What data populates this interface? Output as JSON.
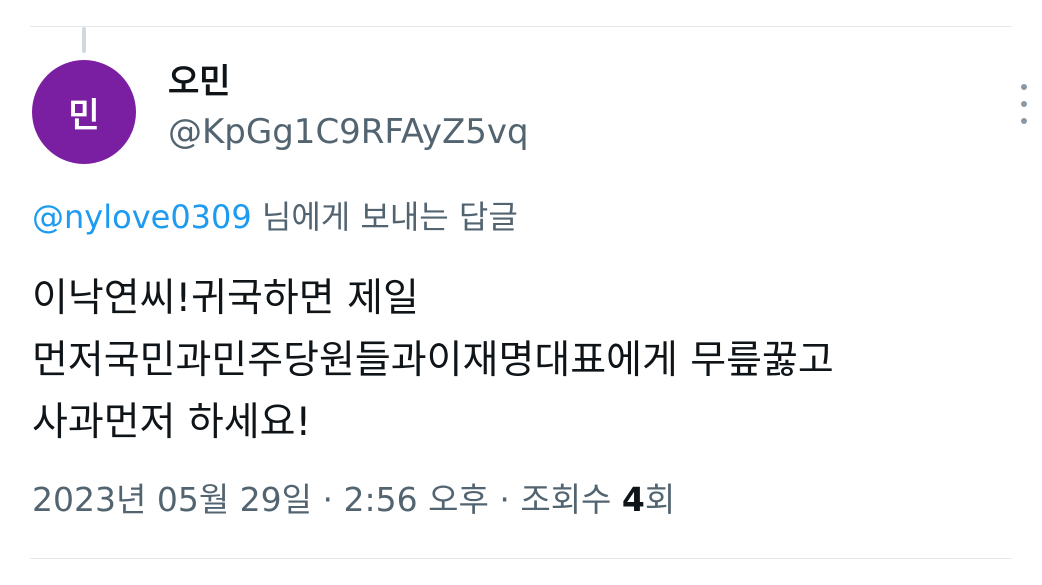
{
  "tweet": {
    "avatar_text": "민",
    "display_name": "오민",
    "handle": "@KpGg1C9RFAyZ5vq",
    "reply_to_handle": "@nylove0309",
    "reply_to_suffix": " 님에게 보내는 답글",
    "text_lines": [
      "이낙연씨!귀국하면 제일",
      "먼저국민과민주당원들과이재명대표에게 무릎꿇고",
      "사과먼저 하세요!"
    ],
    "date": "2023년 05월 29일",
    "separator": " · ",
    "time": "2:56 오후",
    "views_label": "조회수 ",
    "views_count": "4",
    "views_suffix": "회"
  },
  "colors": {
    "avatar_bg": "#7b1fa2",
    "mention": "#1d9bf0",
    "secondary_text": "#536471",
    "primary_text": "#0f1419"
  },
  "icons": {
    "more": "more-vertical-icon"
  }
}
